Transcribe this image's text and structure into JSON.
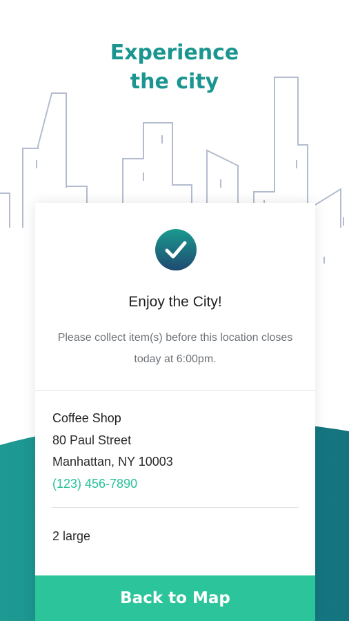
{
  "header": {
    "title_line1": "Experience",
    "title_line2": "the city"
  },
  "confirmation": {
    "title": "Enjoy the City!",
    "message": "Please collect item(s) before this location closes today at 6:00pm."
  },
  "location": {
    "name": "Coffee Shop",
    "address_line1": "80 Paul Street",
    "address_line2": "Manhattan, NY 10003",
    "phone": "(123) 456-7890"
  },
  "order": {
    "summary": "2 large"
  },
  "actions": {
    "back_label": "Back to Map"
  },
  "icons": {
    "check": "check-circle-icon",
    "skyline": "city-skyline-illustration"
  },
  "colors": {
    "brand_teal": "#1a958f",
    "button_green": "#2cc49b",
    "link_green": "#27c29a",
    "wave_dark": "#167d86",
    "badge_dark": "#1f4a70",
    "skyline_stroke": "#b3bccf"
  }
}
